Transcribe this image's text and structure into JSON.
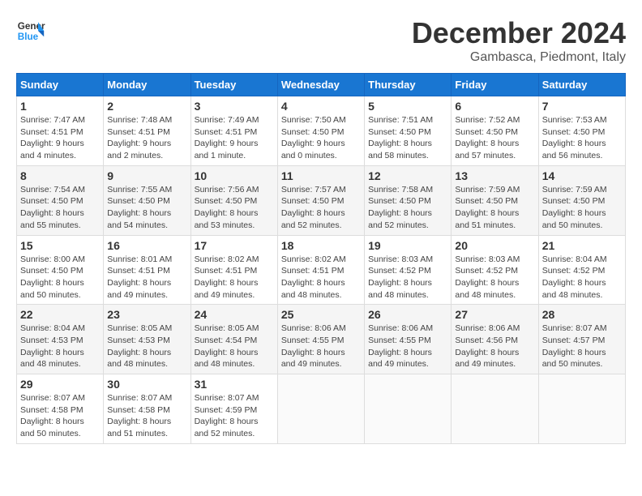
{
  "header": {
    "logo_text_general": "General",
    "logo_text_blue": "Blue",
    "month_title": "December 2024",
    "location": "Gambasca, Piedmont, Italy"
  },
  "calendar": {
    "days_of_week": [
      "Sunday",
      "Monday",
      "Tuesday",
      "Wednesday",
      "Thursday",
      "Friday",
      "Saturday"
    ],
    "weeks": [
      [
        {
          "day": "1",
          "sunrise": "7:47 AM",
          "sunset": "4:51 PM",
          "daylight": "9 hours and 4 minutes."
        },
        {
          "day": "2",
          "sunrise": "7:48 AM",
          "sunset": "4:51 PM",
          "daylight": "9 hours and 2 minutes."
        },
        {
          "day": "3",
          "sunrise": "7:49 AM",
          "sunset": "4:51 PM",
          "daylight": "9 hours and 1 minute."
        },
        {
          "day": "4",
          "sunrise": "7:50 AM",
          "sunset": "4:50 PM",
          "daylight": "9 hours and 0 minutes."
        },
        {
          "day": "5",
          "sunrise": "7:51 AM",
          "sunset": "4:50 PM",
          "daylight": "8 hours and 58 minutes."
        },
        {
          "day": "6",
          "sunrise": "7:52 AM",
          "sunset": "4:50 PM",
          "daylight": "8 hours and 57 minutes."
        },
        {
          "day": "7",
          "sunrise": "7:53 AM",
          "sunset": "4:50 PM",
          "daylight": "8 hours and 56 minutes."
        }
      ],
      [
        {
          "day": "8",
          "sunrise": "7:54 AM",
          "sunset": "4:50 PM",
          "daylight": "8 hours and 55 minutes."
        },
        {
          "day": "9",
          "sunrise": "7:55 AM",
          "sunset": "4:50 PM",
          "daylight": "8 hours and 54 minutes."
        },
        {
          "day": "10",
          "sunrise": "7:56 AM",
          "sunset": "4:50 PM",
          "daylight": "8 hours and 53 minutes."
        },
        {
          "day": "11",
          "sunrise": "7:57 AM",
          "sunset": "4:50 PM",
          "daylight": "8 hours and 52 minutes."
        },
        {
          "day": "12",
          "sunrise": "7:58 AM",
          "sunset": "4:50 PM",
          "daylight": "8 hours and 52 minutes."
        },
        {
          "day": "13",
          "sunrise": "7:59 AM",
          "sunset": "4:50 PM",
          "daylight": "8 hours and 51 minutes."
        },
        {
          "day": "14",
          "sunrise": "7:59 AM",
          "sunset": "4:50 PM",
          "daylight": "8 hours and 50 minutes."
        }
      ],
      [
        {
          "day": "15",
          "sunrise": "8:00 AM",
          "sunset": "4:50 PM",
          "daylight": "8 hours and 50 minutes."
        },
        {
          "day": "16",
          "sunrise": "8:01 AM",
          "sunset": "4:51 PM",
          "daylight": "8 hours and 49 minutes."
        },
        {
          "day": "17",
          "sunrise": "8:02 AM",
          "sunset": "4:51 PM",
          "daylight": "8 hours and 49 minutes."
        },
        {
          "day": "18",
          "sunrise": "8:02 AM",
          "sunset": "4:51 PM",
          "daylight": "8 hours and 48 minutes."
        },
        {
          "day": "19",
          "sunrise": "8:03 AM",
          "sunset": "4:52 PM",
          "daylight": "8 hours and 48 minutes."
        },
        {
          "day": "20",
          "sunrise": "8:03 AM",
          "sunset": "4:52 PM",
          "daylight": "8 hours and 48 minutes."
        },
        {
          "day": "21",
          "sunrise": "8:04 AM",
          "sunset": "4:52 PM",
          "daylight": "8 hours and 48 minutes."
        }
      ],
      [
        {
          "day": "22",
          "sunrise": "8:04 AM",
          "sunset": "4:53 PM",
          "daylight": "8 hours and 48 minutes."
        },
        {
          "day": "23",
          "sunrise": "8:05 AM",
          "sunset": "4:53 PM",
          "daylight": "8 hours and 48 minutes."
        },
        {
          "day": "24",
          "sunrise": "8:05 AM",
          "sunset": "4:54 PM",
          "daylight": "8 hours and 48 minutes."
        },
        {
          "day": "25",
          "sunrise": "8:06 AM",
          "sunset": "4:55 PM",
          "daylight": "8 hours and 49 minutes."
        },
        {
          "day": "26",
          "sunrise": "8:06 AM",
          "sunset": "4:55 PM",
          "daylight": "8 hours and 49 minutes."
        },
        {
          "day": "27",
          "sunrise": "8:06 AM",
          "sunset": "4:56 PM",
          "daylight": "8 hours and 49 minutes."
        },
        {
          "day": "28",
          "sunrise": "8:07 AM",
          "sunset": "4:57 PM",
          "daylight": "8 hours and 50 minutes."
        }
      ],
      [
        {
          "day": "29",
          "sunrise": "8:07 AM",
          "sunset": "4:58 PM",
          "daylight": "8 hours and 50 minutes."
        },
        {
          "day": "30",
          "sunrise": "8:07 AM",
          "sunset": "4:58 PM",
          "daylight": "8 hours and 51 minutes."
        },
        {
          "day": "31",
          "sunrise": "8:07 AM",
          "sunset": "4:59 PM",
          "daylight": "8 hours and 52 minutes."
        },
        null,
        null,
        null,
        null
      ]
    ]
  }
}
